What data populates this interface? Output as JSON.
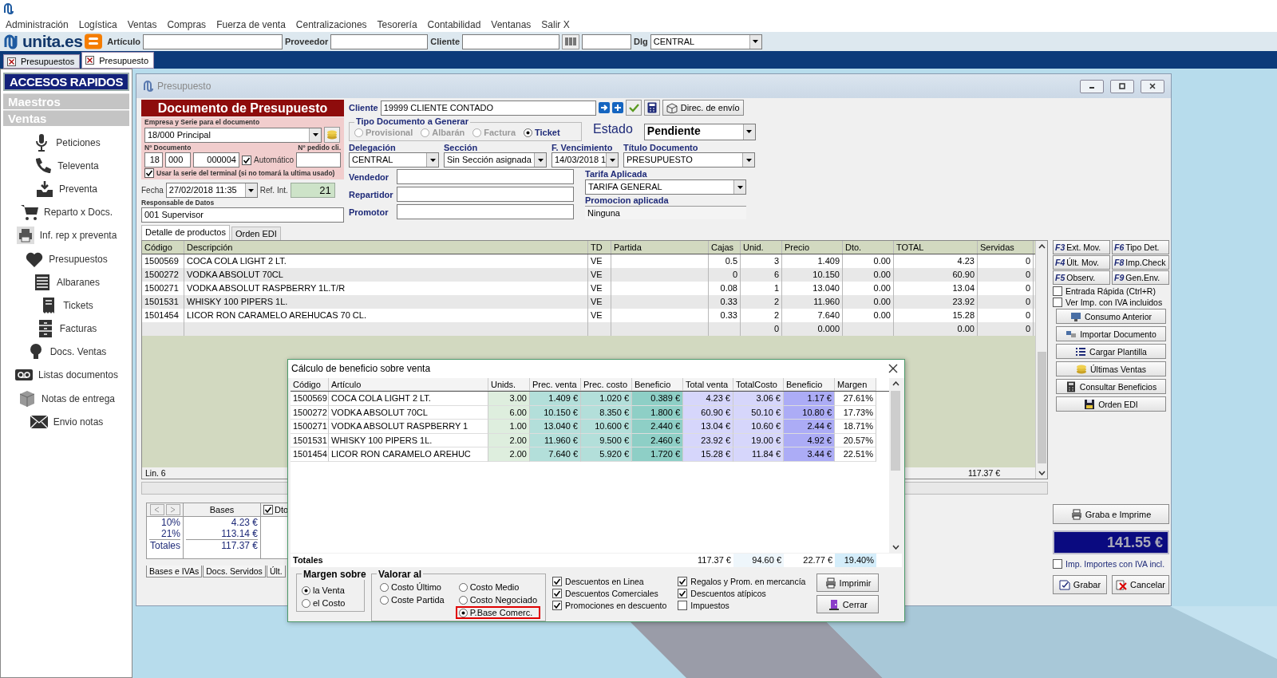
{
  "menu": [
    "Administración",
    "Logística",
    "Ventas",
    "Compras",
    "Fuerza de venta",
    "Centralizaciones",
    "Tesorería",
    "Contabilidad",
    "Ventanas",
    "Salir X"
  ],
  "toolbar": {
    "logo": "unita.es",
    "fields": [
      {
        "label": "Artículo"
      },
      {
        "label": "Proveedor"
      },
      {
        "label": "Cliente"
      }
    ],
    "dlg": {
      "label": "Dlg",
      "value": "CENTRAL"
    }
  },
  "doc_tabs": [
    {
      "label": "Presupuestos",
      "selected": false
    },
    {
      "label": "Presupuesto",
      "selected": true
    }
  ],
  "sidebar": {
    "title": "ACCESOS RAPIDOS",
    "sections": [
      "Maestros",
      "Ventas"
    ],
    "items": [
      {
        "label": "Peticiones",
        "kind": "microphone"
      },
      {
        "label": "Televenta",
        "kind": "phone"
      },
      {
        "label": "Preventa",
        "kind": "inbox"
      },
      {
        "label": "Reparto x Docs.",
        "kind": "cart"
      },
      {
        "label": "Inf. rep x preventa",
        "kind": "printer"
      },
      {
        "label": "Presupuestos",
        "kind": "heart"
      },
      {
        "label": "Albaranes",
        "kind": "list"
      },
      {
        "label": "Tickets",
        "kind": "receipt"
      },
      {
        "label": "Facturas",
        "kind": "cabinet"
      },
      {
        "label": "Docs. Ventas",
        "kind": "bulb"
      },
      {
        "label": "Listas documentos",
        "kind": "tape"
      },
      {
        "label": "Notas de entrega",
        "kind": "box"
      },
      {
        "label": "Envio notas",
        "kind": "envelope"
      }
    ]
  },
  "window": {
    "title": "Presupuesto"
  },
  "document": {
    "heading": "Documento de Presupuesto",
    "series_label": "Empresa y Serie para el documento",
    "series": "18/000 Principal",
    "number_label": "Nº Documento",
    "number": [
      "18",
      "000",
      "000004"
    ],
    "automatic": {
      "label": "Automático",
      "checked": true
    },
    "order_label": "Nº pedido cli.",
    "terminal": {
      "label": "Usar la serie del terminal (si no tomará la ultima usado)",
      "checked": true
    },
    "date_label": "Fecha",
    "date": "27/02/2018 11:35",
    "ref_label": "Ref. Int.",
    "ref": "21",
    "responsible_label": "Responsable de Datos",
    "responsible": "001 Supervisor"
  },
  "client": {
    "label": "Cliente",
    "value": "19999 CLIENTE CONTADO",
    "ship_button": "Direc. de envío",
    "type_group": {
      "title": "Tipo Documento a Generar",
      "options": [
        {
          "label": "Provisional",
          "selected": false,
          "disabled": true
        },
        {
          "label": "Albarán",
          "selected": false,
          "disabled": true
        },
        {
          "label": "Factura",
          "selected": false,
          "disabled": true
        },
        {
          "label": "Ticket",
          "selected": true,
          "disabled": false
        }
      ]
    },
    "state": {
      "label": "Estado",
      "value": "Pendiente"
    },
    "combos": [
      {
        "label": "Delegación",
        "value": "CENTRAL"
      },
      {
        "label": "Sección",
        "value": "Sin Sección asignada"
      },
      {
        "label": "F. Vencimiento",
        "value": "14/03/2018 1"
      },
      {
        "label": "Título Documento",
        "value": "PRESUPUESTO"
      }
    ],
    "people": [
      {
        "label": "Vendedor"
      },
      {
        "label": "Repartidor"
      },
      {
        "label": "Promotor"
      }
    ],
    "rate": {
      "label": "Tarifa Aplicada",
      "value": "TARIFA GENERAL"
    },
    "promo": {
      "label": "Promocion aplicada",
      "value": "Ninguna"
    }
  },
  "products": {
    "tabs": [
      {
        "label": "Detalle de productos",
        "selected": true
      },
      {
        "label": "Orden EDI",
        "selected": false
      }
    ],
    "columns": [
      "Código",
      "Descripción",
      "TD",
      "Partida",
      "Cajas",
      "Unid.",
      "Precio",
      "Dto.",
      "TOTAL",
      "Servidas"
    ],
    "rows": [
      {
        "code": "1500569",
        "description": "COCA COLA LIGHT 2 LT.",
        "td": "VE",
        "cajas": "0.5",
        "unid": "3",
        "precio": "1.409",
        "dto": "0.00",
        "total": "4.23",
        "servidas": "0"
      },
      {
        "code": "1500272",
        "description": "VODKA ABSOLUT 70CL",
        "td": "VE",
        "cajas": "0",
        "unid": "6",
        "precio": "10.150",
        "dto": "0.00",
        "total": "60.90",
        "servidas": "0"
      },
      {
        "code": "1500271",
        "description": "VODKA ABSOLUT RASPBERRY 1L.T/R",
        "td": "VE",
        "cajas": "0.08",
        "unid": "1",
        "precio": "13.040",
        "dto": "0.00",
        "total": "13.04",
        "servidas": "0"
      },
      {
        "code": "1501531",
        "description": "WHISKY 100 PIPERS 1L.",
        "td": "VE",
        "cajas": "0.33",
        "unid": "2",
        "precio": "11.960",
        "dto": "0.00",
        "total": "23.92",
        "servidas": "0"
      },
      {
        "code": "1501454",
        "description": "LICOR RON CARAMELO AREHUCAS 70 CL.",
        "td": "VE",
        "cajas": "0.33",
        "unid": "2",
        "precio": "7.640",
        "dto": "0.00",
        "total": "15.28",
        "servidas": "0"
      },
      {
        "unid": "0",
        "precio": "0.000",
        "total": "0.00",
        "servidas": "0"
      }
    ],
    "status": "Lin. 6",
    "total": "117.37 €"
  },
  "actions": {
    "fkeys": [
      {
        "key": "F3",
        "label": "Ext. Mov."
      },
      {
        "key": "F6",
        "label": "Tipo Det."
      },
      {
        "key": "F4",
        "label": "Últ. Mov."
      },
      {
        "key": "F8",
        "label": "Imp.Check"
      },
      {
        "key": "F5",
        "label": "Observ."
      },
      {
        "key": "F9",
        "label": "Gen.Env."
      }
    ],
    "checks": [
      {
        "label": "Entrada Rápida (Ctrl+R)",
        "checked": false
      },
      {
        "label": "Ver Imp. con IVA incluidos",
        "checked": false
      }
    ],
    "buttons": [
      {
        "label": "Consumo Anterior",
        "kind": "computer"
      },
      {
        "label": "Importar Documento",
        "kind": "cards"
      },
      {
        "label": "Cargar Plantilla",
        "kind": "list"
      },
      {
        "label": "Últimas Ventas",
        "kind": "coins"
      },
      {
        "label": "Consultar Beneficios",
        "kind": "calculator"
      },
      {
        "label": "Orden EDI",
        "kind": "floppy"
      }
    ],
    "print_save": "Graba e Imprime",
    "grand_total": "141.55 €",
    "vat_check": {
      "label": "Imp. Importes con IVA incl.",
      "checked": false
    },
    "save": "Grabar",
    "cancel": "Cancelar"
  },
  "taxes": {
    "header": "Bases",
    "discount": {
      "label": "Dto",
      "checked": true
    },
    "rows": [
      [
        "10%",
        "4.23 €"
      ],
      [
        "21%",
        "113.14 €"
      ],
      [
        "Totales",
        "117.37 €"
      ]
    ],
    "tabs": [
      "Bases e IVAs",
      "Docs. Servidos",
      "Últ."
    ]
  },
  "dialog": {
    "title": "Cálculo de beneficio sobre venta",
    "columns": [
      "Código",
      "Artículo",
      "Unids.",
      "Prec. venta",
      "Prec. costo",
      "Beneficio",
      "Total venta",
      "TotalCosto",
      "Beneficio",
      "Margen"
    ],
    "rows": [
      [
        "1500569",
        "COCA COLA LIGHT 2 LT.",
        "3.00",
        "1.409 €",
        "1.020 €",
        "0.389 €",
        "4.23 €",
        "3.06 €",
        "1.17 €",
        "27.61%"
      ],
      [
        "1500272",
        "VODKA ABSOLUT 70CL",
        "6.00",
        "10.150 €",
        "8.350 €",
        "1.800 €",
        "60.90 €",
        "50.10 €",
        "10.80 €",
        "17.73%"
      ],
      [
        "1500271",
        "VODKA ABSOLUT RASPBERRY 1",
        "1.00",
        "13.040 €",
        "10.600 €",
        "2.440 €",
        "13.04 €",
        "10.60 €",
        "2.44 €",
        "18.71%"
      ],
      [
        "1501531",
        "WHISKY 100 PIPERS 1L.",
        "2.00",
        "11.960 €",
        "9.500 €",
        "2.460 €",
        "23.92 €",
        "19.00 €",
        "4.92 €",
        "20.57%"
      ],
      [
        "1501454",
        "LICOR RON CARAMELO AREHUC",
        "2.00",
        "7.640 €",
        "5.920 €",
        "1.720 €",
        "15.28 €",
        "11.84 €",
        "3.44 €",
        "22.51%"
      ]
    ],
    "totals_label": "Totales",
    "totals": [
      "117.37 €",
      "94.60 €",
      "22.77 €",
      "19.40%"
    ],
    "margin": {
      "title": "Margen sobre",
      "options": [
        {
          "label": "la Venta",
          "selected": true
        },
        {
          "label": "el Costo",
          "selected": false
        }
      ]
    },
    "value_at": {
      "title": "Valorar al",
      "options": [
        {
          "label": "Costo Último",
          "selected": false,
          "highlighted": false
        },
        {
          "label": "Coste Partida",
          "selected": false,
          "highlighted": false
        },
        {
          "label": "Costo Medio",
          "selected": false,
          "highlighted": false
        },
        {
          "label": "Costo Negociado",
          "selected": false,
          "highlighted": false
        },
        {
          "label": "P.Base Comerc.",
          "selected": true,
          "highlighted": true
        }
      ]
    },
    "checks": [
      {
        "label": "Descuentos en Linea",
        "checked": true
      },
      {
        "label": "Descuentos Comerciales",
        "checked": true
      },
      {
        "label": "Promociones en descuento",
        "checked": true
      },
      {
        "label": "Regalos y Prom. en mercancía",
        "checked": true
      },
      {
        "label": "Descuentos atípicos",
        "checked": true
      },
      {
        "label": "Impuestos",
        "checked": false
      }
    ],
    "buttons": [
      {
        "label": "Imprimir",
        "kind": "printer"
      },
      {
        "label": "Cerrar",
        "kind": "door"
      }
    ]
  }
}
